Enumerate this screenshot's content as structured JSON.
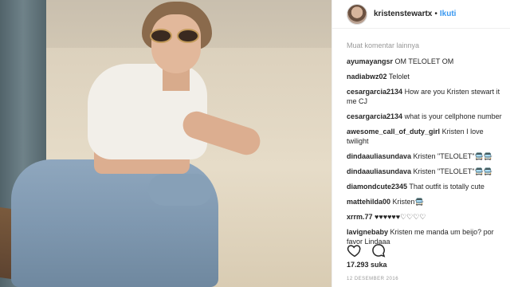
{
  "post": {
    "username": "kristenstewartx",
    "separator": "•",
    "follow_label": "Ikuti",
    "load_more": "Muat komentar lainnya",
    "comments": [
      {
        "user": "ayumayangsr",
        "text": "OM TELOLET OM"
      },
      {
        "user": "nadiabwz02",
        "text": "Telolet"
      },
      {
        "user": "cesargarcia2134",
        "text": "How are you Kristen stewart it me CJ"
      },
      {
        "user": "cesargarcia2134",
        "text": "what is your cellphone number"
      },
      {
        "user": "awesome_call_of_duty_girl",
        "text": "Kristen I love twilight"
      },
      {
        "user": "dindaauliasundava",
        "text": "Kristen \"TELOLET\"🚍🚍"
      },
      {
        "user": "dindaauliasundava",
        "text": "Kristen \"TELOLET\"🚍🚍"
      },
      {
        "user": "diamondcute2345",
        "text": "That outfit is totally cute"
      },
      {
        "user": "mattehilda00",
        "text": "Kristen🚍"
      },
      {
        "user": "xrrm.77",
        "text": "♥♥♥♥♥♥♡♡♡♡"
      },
      {
        "user": "lavignebaby",
        "text": "Kristen me manda um beijo? por favor Lindaaa"
      }
    ],
    "likes": "17.293 suka",
    "date": "12 DESEMBER 2016"
  },
  "icons": {
    "like": "heart-icon",
    "comment": "comment-icon"
  }
}
